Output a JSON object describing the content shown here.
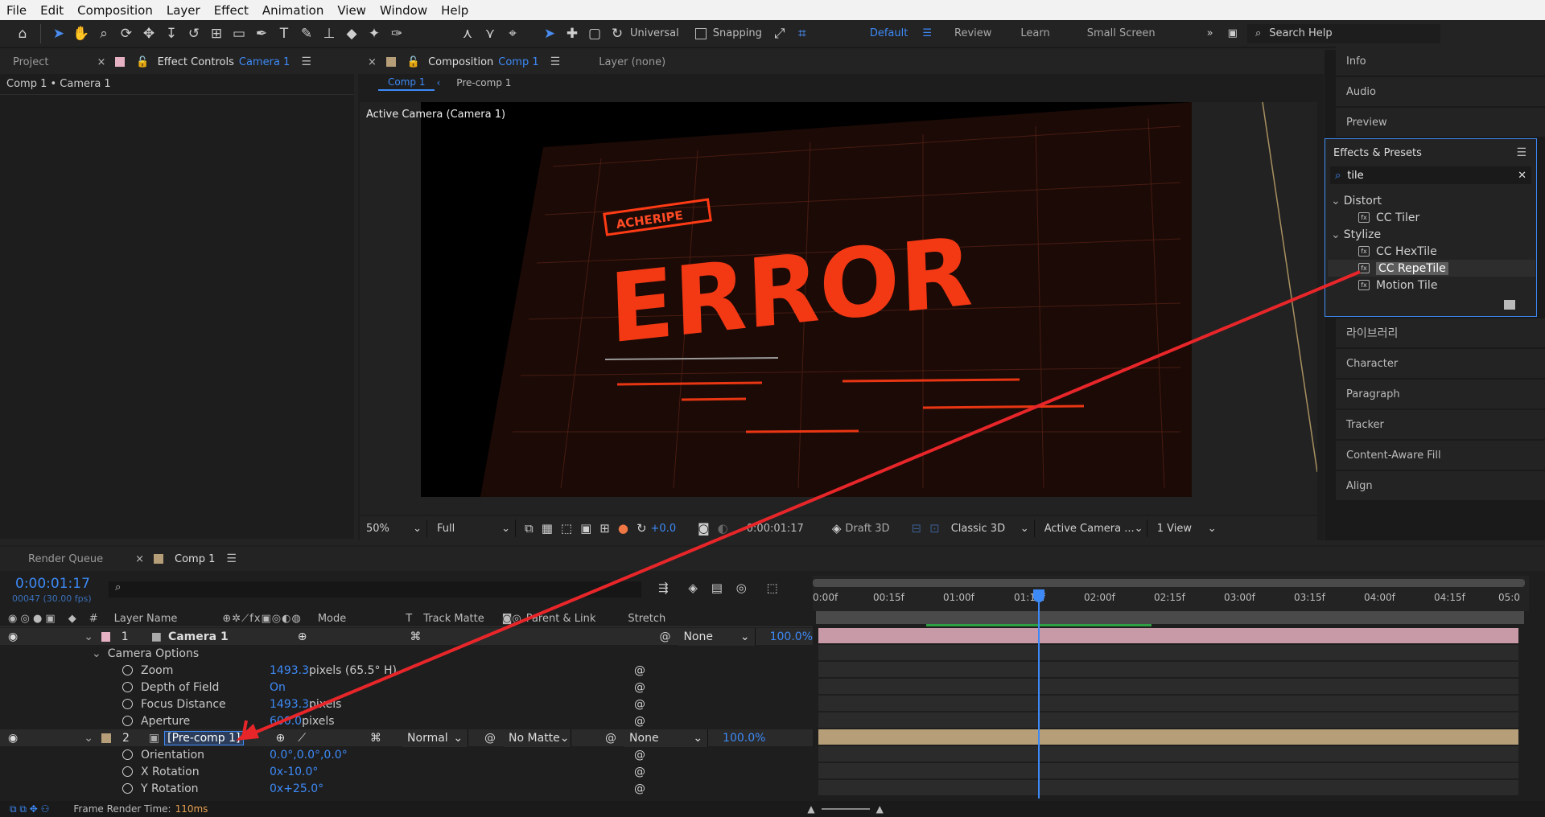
{
  "menu": [
    "File",
    "Edit",
    "Composition",
    "Layer",
    "Effect",
    "Animation",
    "View",
    "Window",
    "Help"
  ],
  "toolbar": {
    "universal_label": "Universal",
    "snapping_label": "Snapping",
    "workspaces": [
      "Default",
      "Review",
      "Learn",
      "Small Screen"
    ],
    "search_placeholder": "Search Help"
  },
  "left_panel": {
    "tab_project": "Project",
    "tab_effect_controls": "Effect Controls",
    "tab_effect_controls_target": "Camera 1",
    "breadcrumb": "Comp 1 • Camera 1"
  },
  "comp_panel": {
    "tab_label": "Composition",
    "tab_target": "Comp 1",
    "layer_tab": "Layer (none)",
    "subtabs": [
      "Comp 1",
      "Pre-comp 1"
    ],
    "camera_label": "Active Camera (Camera 1)",
    "error_text": "ERROR",
    "badge_text": "ACHERIPE",
    "zoom": "50%",
    "resolution": "Full",
    "exposure": "+0.0",
    "timecode": "0:00:01:17",
    "draft3d": "Draft 3D",
    "renderer": "Classic 3D",
    "camera_view": "Active Camera ...",
    "views": "1 View"
  },
  "right_panel": {
    "items_top": [
      "Info",
      "Audio",
      "Preview"
    ],
    "effects_title": "Effects & Presets",
    "search_value": "tile",
    "groups": [
      {
        "name": "Distort",
        "items": [
          "CC Tiler"
        ]
      },
      {
        "name": "Stylize",
        "items": [
          "CC HexTile",
          "CC RepeTile",
          "Motion Tile"
        ]
      }
    ],
    "items_bottom": [
      "라이브러리",
      "Character",
      "Paragraph",
      "Tracker",
      "Content-Aware Fill",
      "Align"
    ]
  },
  "timeline": {
    "tab_render_queue": "Render Queue",
    "tab_comp": "Comp 1",
    "timecode": "0:00:01:17",
    "frame_info": "00047 (30.00 fps)",
    "headers": {
      "num": "#",
      "layer_name": "Layer Name",
      "mode": "Mode",
      "t": "T",
      "track_matte": "Track Matte",
      "parent": "Parent & Link",
      "stretch": "Stretch"
    },
    "ruler": [
      "0:00f",
      "00:15f",
      "01:00f",
      "01:15f",
      "02:00f",
      "02:15f",
      "03:00f",
      "03:15f",
      "04:00f",
      "04:15f",
      "05:0"
    ],
    "layers": [
      {
        "num": "1",
        "name": "Camera 1",
        "parent": "None",
        "stretch": "100.0%",
        "section": "Camera Options",
        "props": [
          {
            "name": "Zoom",
            "value": "1493.3",
            "unit": " pixels (65.5° H)"
          },
          {
            "name": "Depth of Field",
            "value": "On",
            "unit": ""
          },
          {
            "name": "Focus Distance",
            "value": "1493.3",
            "unit": " pixels"
          },
          {
            "name": "Aperture",
            "value": "600.0",
            "unit": " pixels"
          }
        ]
      },
      {
        "num": "2",
        "name": "[Pre-comp 1]",
        "mode": "Normal",
        "track_matte": "No Matte",
        "parent": "None",
        "stretch": "100.0%",
        "props": [
          {
            "name": "Orientation",
            "value": "0.0°,0.0°,0.0°",
            "unit": ""
          },
          {
            "name": "X Rotation",
            "value": "0x-10.0°",
            "unit": ""
          },
          {
            "name": "Y Rotation",
            "value": "0x+25.0°",
            "unit": ""
          }
        ]
      }
    ],
    "status": "Frame Render Time:",
    "status_value": "110ms"
  },
  "colors": {
    "accent": "#3d8af7",
    "arrow": "#e8262a",
    "camera_label": "#e7b1c4",
    "precomp_label": "#b69e78"
  }
}
